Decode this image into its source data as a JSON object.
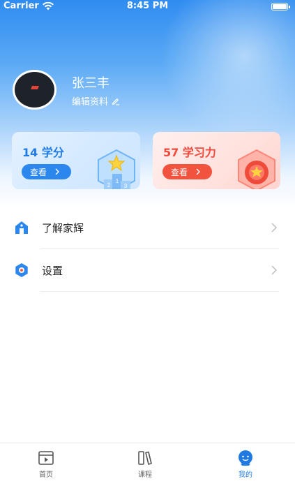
{
  "status_bar": {
    "carrier": "Carrier",
    "time": "8:45 PM"
  },
  "profile": {
    "name": "张三丰",
    "edit_label": "编辑资料"
  },
  "cards": {
    "credits": {
      "value_label": "14 学分",
      "button_label": "查看"
    },
    "power": {
      "value_label": "57 学习力",
      "button_label": "查看"
    }
  },
  "menu": {
    "items": [
      {
        "label": "了解家辉",
        "icon": "house-icon"
      },
      {
        "label": "设置",
        "icon": "gear-icon"
      }
    ]
  },
  "tabbar": {
    "tabs": [
      {
        "label": "首页",
        "icon": "home-video-icon",
        "active": false
      },
      {
        "label": "课程",
        "icon": "books-icon",
        "active": false
      },
      {
        "label": "我的",
        "icon": "profile-icon",
        "active": true
      }
    ]
  },
  "colors": {
    "primary_blue": "#2b86ee",
    "accent_red": "#f2533f",
    "active_tab": "#1f7be3"
  }
}
